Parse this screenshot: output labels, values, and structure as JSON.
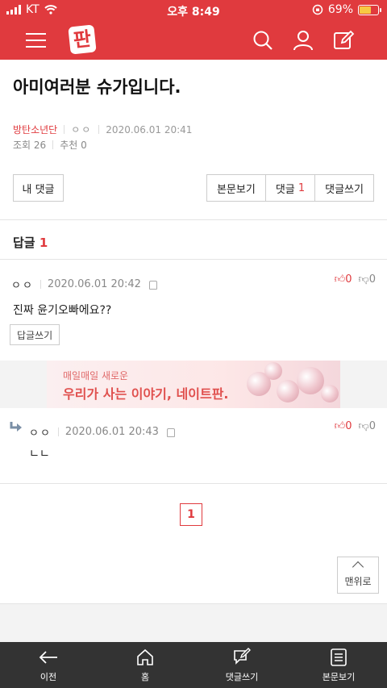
{
  "status_bar": {
    "carrier": "KT",
    "time": "오후 8:49",
    "battery_percent": "69%",
    "battery_level": 0.69
  },
  "header": {
    "logo_text": "판",
    "icons": [
      "menu-icon",
      "search-icon",
      "user-icon",
      "write-icon"
    ]
  },
  "post": {
    "title": "아미여러분 슈가입니다.",
    "category": "방탄소년단",
    "author": "ㅇㅇ",
    "datetime": "2020.06.01 20:41",
    "views_label": "조회",
    "views": "26",
    "recommend_label": "추천",
    "recommend": "0"
  },
  "actions": {
    "my_comments": "내 댓글",
    "view_body": "본문보기",
    "comments_label": "댓글",
    "comments_count": "1",
    "write_comment": "댓글쓰기"
  },
  "replies": {
    "label": "답글",
    "count": "1"
  },
  "comments": [
    {
      "nick": "ㅇㅇ",
      "datetime": "2020.06.01 20:42",
      "up": "0",
      "down": "0",
      "body": "진짜 윤기오빠에요??",
      "reply_button": "답글쓰기"
    },
    {
      "nick": "ㅇㅇ",
      "datetime": "2020.06.01 20:43",
      "up": "0",
      "down": "0",
      "body": "ㄴㄴ"
    }
  ],
  "ad": {
    "line1": "매일매일 새로운",
    "line2": "우리가 사는 이야기, 네이트판."
  },
  "pagination": {
    "current": "1"
  },
  "top_button": "맨위로",
  "tabbar": {
    "items": [
      {
        "label": "이전",
        "icon": "back-arrow-icon"
      },
      {
        "label": "홈",
        "icon": "home-icon"
      },
      {
        "label": "댓글쓰기",
        "icon": "comment-write-icon"
      },
      {
        "label": "본문보기",
        "icon": "document-icon"
      }
    ]
  },
  "colors": {
    "brand": "#e03a3e",
    "tabbar": "#333333"
  }
}
